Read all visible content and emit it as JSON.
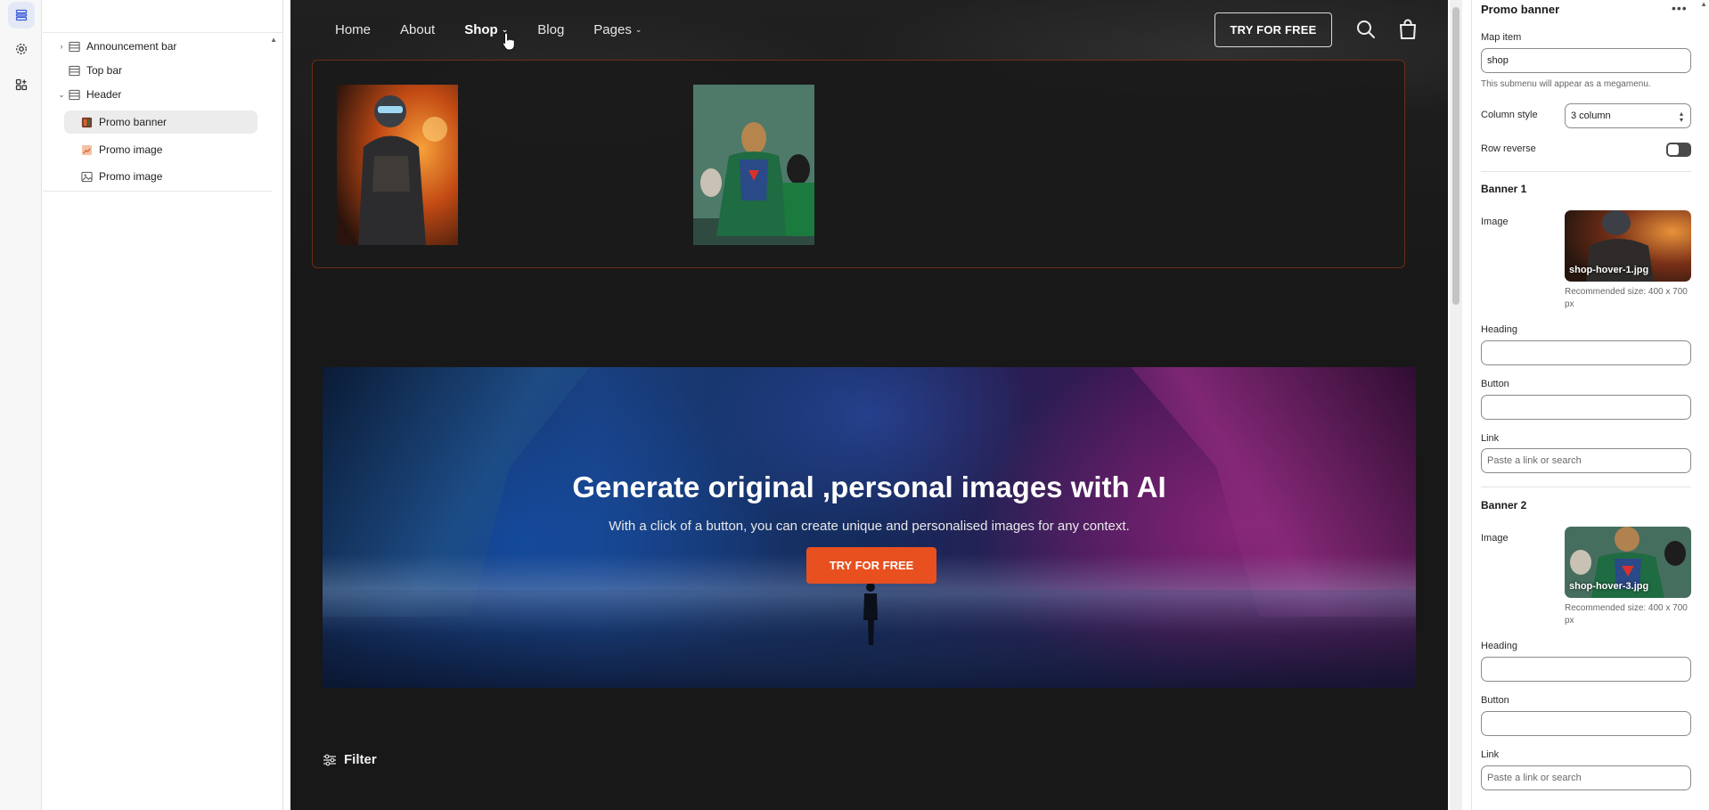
{
  "tree": {
    "items": [
      {
        "label": "Announcement bar"
      },
      {
        "label": "Top bar"
      },
      {
        "label": "Header"
      },
      {
        "label": "Promo banner"
      },
      {
        "label": "Promo image"
      },
      {
        "label": "Promo image"
      }
    ]
  },
  "preview": {
    "nav": [
      {
        "label": "Home"
      },
      {
        "label": "About"
      },
      {
        "label": "Shop"
      },
      {
        "label": "Blog"
      },
      {
        "label": "Pages"
      }
    ],
    "try_label": "TRY FOR FREE",
    "hero": {
      "title": "Generate original ,personal images with AI",
      "subtitle": "With a click of a button, you can create unique and personalised images for any context.",
      "button": "TRY FOR FREE"
    },
    "filter_label": "Filter"
  },
  "settings": {
    "title": "Promo banner",
    "map_item_label": "Map item",
    "map_item_value": "shop",
    "map_item_help": "This submenu will appear as a megamenu.",
    "column_style_label": "Column style",
    "column_style_value": "3 column",
    "row_reverse_label": "Row reverse",
    "row_reverse_on": false,
    "banners": [
      {
        "heading": "Banner 1",
        "image_label": "Image",
        "image_file": "shop-hover-1.jpg",
        "recommended": "Recommended size: 400 x 700 px",
        "heading_label": "Heading",
        "heading_value": "",
        "button_label": "Button",
        "button_value": "",
        "link_label": "Link",
        "link_placeholder": "Paste a link or search"
      },
      {
        "heading": "Banner 2",
        "image_label": "Image",
        "image_file": "shop-hover-3.jpg",
        "recommended": "Recommended size: 400 x 700 px",
        "heading_label": "Heading",
        "heading_value": "",
        "button_label": "Button",
        "button_value": "",
        "link_label": "Link",
        "link_placeholder": "Paste a link or search"
      }
    ]
  },
  "colors": {
    "accent_orange": "#e8501f",
    "preview_bg": "#181818",
    "selected_row": "#ececec"
  },
  "icons": {
    "rail": [
      "sections-icon",
      "settings-gear-icon",
      "apps-icon"
    ],
    "header": [
      "search-icon",
      "cart-bag-icon"
    ]
  }
}
